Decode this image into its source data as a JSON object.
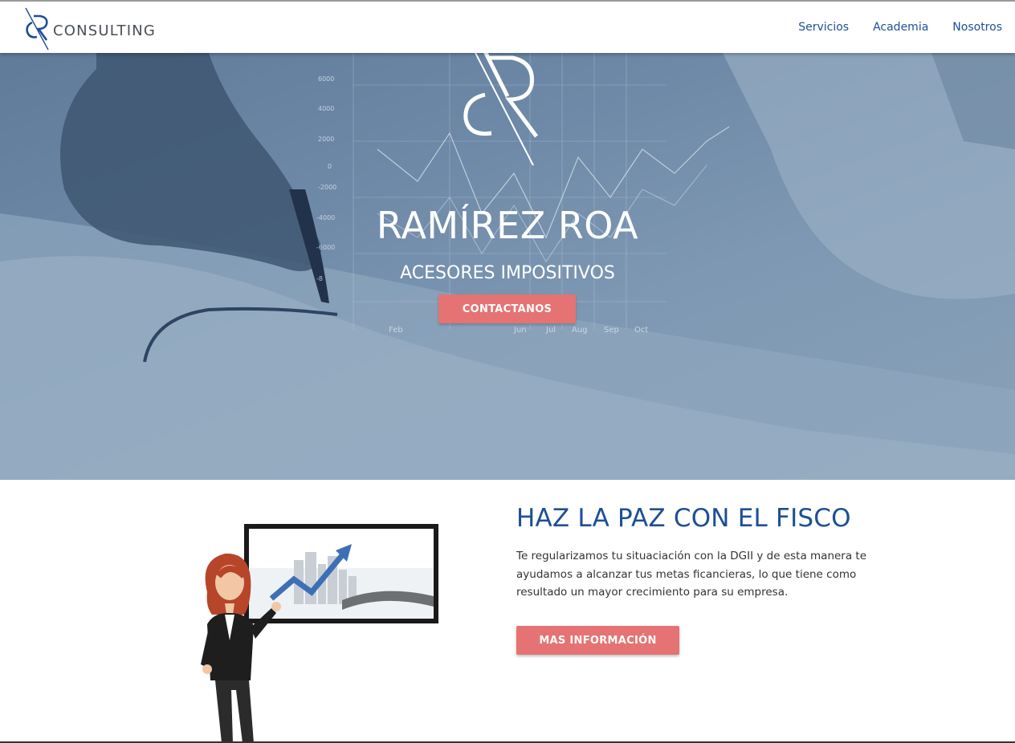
{
  "header": {
    "brand_text": "CONSULTING",
    "nav": [
      "Servicios",
      "Academia",
      "Nosotros"
    ]
  },
  "hero": {
    "title": "RAMÍREZ ROA",
    "subtitle": "ACESORES IMPOSITIVOS",
    "cta_label": "CONTACTANOS",
    "chart_y_ticks": [
      "6000",
      "4000",
      "2000",
      "0",
      "-2000",
      "-4000",
      "-6000",
      "-8"
    ],
    "chart_x_ticks": [
      "Feb",
      "Jun",
      "Jul",
      "Aug",
      "Sep",
      "Oct"
    ]
  },
  "section": {
    "title": "HAZ LA PAZ CON EL FISCO",
    "text": "Te regularizamos tu situaciación con la DGII y de esta manera te ayudamos a alcanzar tus metas ficancieras, lo que tiene como resultado un mayor crecimiento para su empresa.",
    "cta_label": "MAS INFORMACIÓN"
  },
  "colors": {
    "brand_blue": "#1d4f96",
    "accent_coral": "#e57373",
    "hero_overlay": "#6f8aa8"
  }
}
